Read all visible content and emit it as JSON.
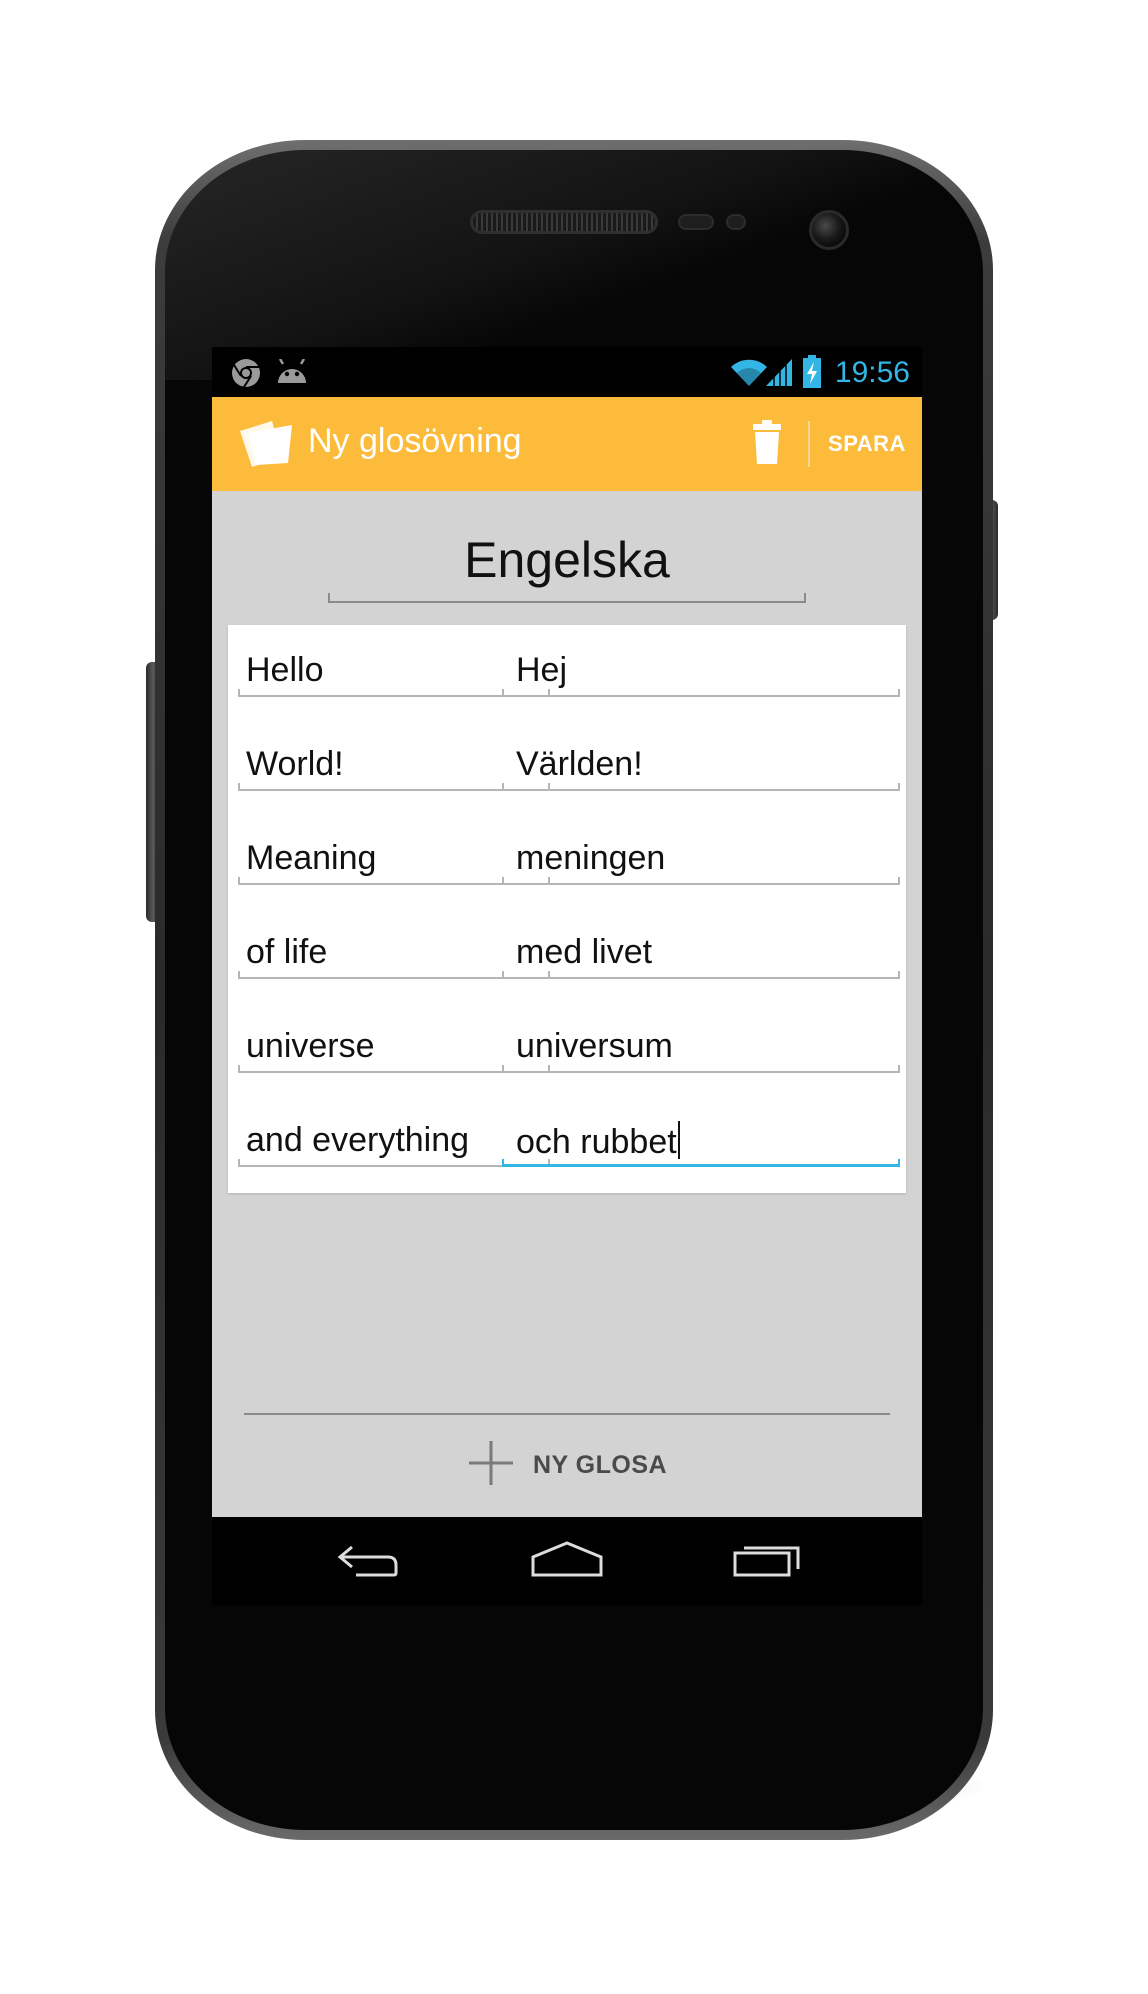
{
  "status_bar": {
    "time": "19:56",
    "left_icons": [
      "chrome-icon",
      "android-icon"
    ],
    "right_icons": [
      "wifi-icon",
      "signal-icon",
      "battery-charging-icon"
    ],
    "accent_color": "#33b5e5"
  },
  "action_bar": {
    "title": "Ny glosövning",
    "save_label": "SPARA",
    "delete_icon": "trash-icon",
    "color": "#fcbb3a"
  },
  "form": {
    "list_title": "Engelska",
    "pairs": [
      {
        "word": "Hello",
        "translation": "Hej"
      },
      {
        "word": "World!",
        "translation": "Världen!"
      },
      {
        "word": "Meaning",
        "translation": "meningen"
      },
      {
        "word": "of life",
        "translation": "med livet"
      },
      {
        "word": "universe",
        "translation": "universum"
      },
      {
        "word": "and everything",
        "translation": "och rubbet"
      }
    ],
    "focused_field": "pair-6-translation"
  },
  "footer": {
    "add_label": "NY GLOSA",
    "add_icon": "plus-icon"
  },
  "nav_bar": {
    "buttons": [
      "back-icon",
      "home-icon",
      "recent-apps-icon"
    ]
  }
}
